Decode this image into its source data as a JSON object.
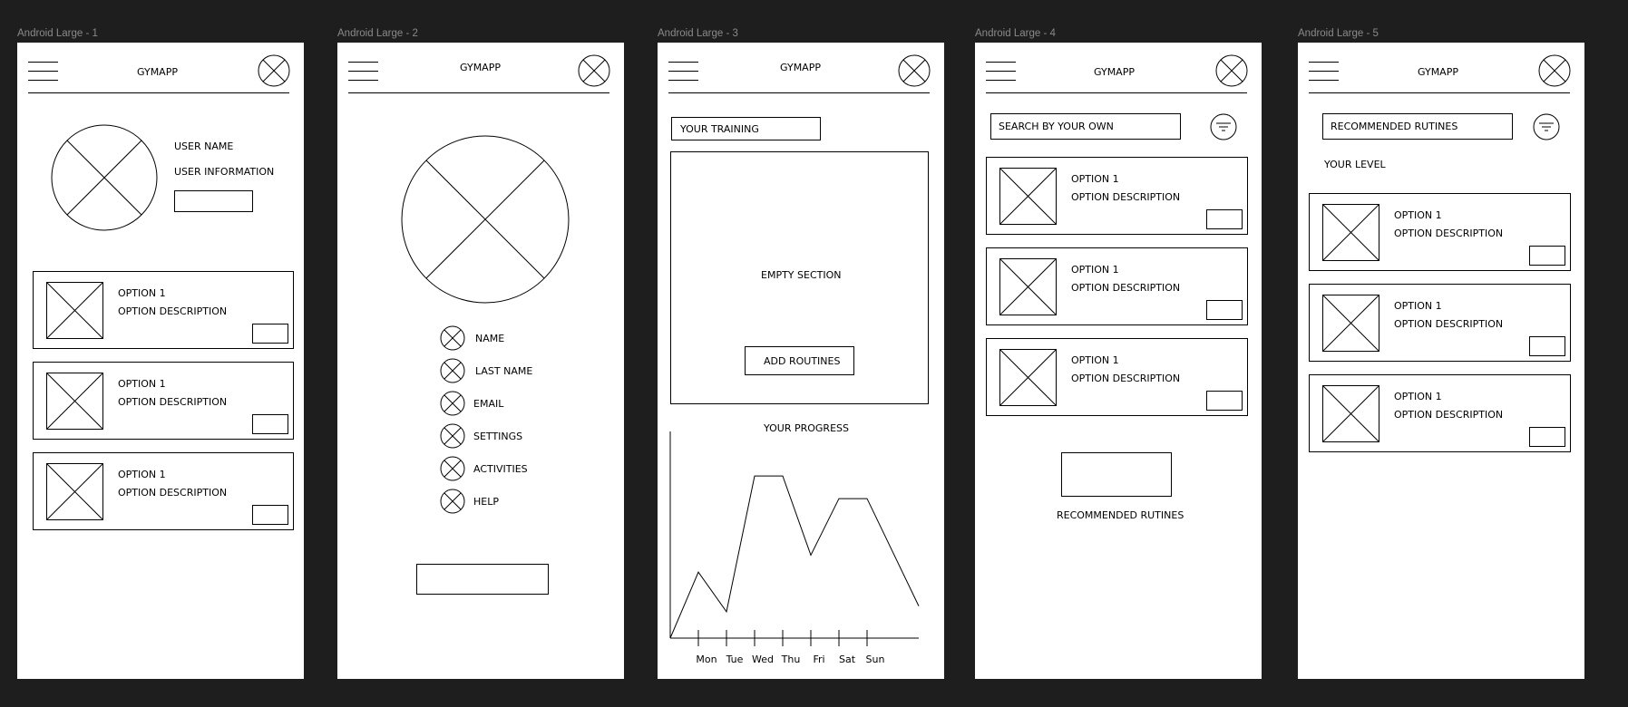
{
  "labels": {
    "f1": "Android Large - 1",
    "f2": "Android Large - 2",
    "f3": "Android Large - 3",
    "f4": "Android Large - 4",
    "f5": "Android Large - 5"
  },
  "app_title": "GYMAPP",
  "profile": {
    "user_name": "USER NAME",
    "user_info": "USER INFORMATION"
  },
  "option": {
    "title": "OPTION 1",
    "description": "OPTION DESCRIPTION"
  },
  "settings_menu": [
    {
      "label": "NAME"
    },
    {
      "label": "LAST NAME"
    },
    {
      "label": "EMAIL"
    },
    {
      "label": "SETTINGS"
    },
    {
      "label": "ACTIVITIES"
    },
    {
      "label": "HELP"
    }
  ],
  "training": {
    "field": "YOUR TRAINING",
    "empty": "EMPTY SECTION",
    "add_button": "ADD ROUTINES",
    "progress_title": "YOUR PROGRESS"
  },
  "search": {
    "placeholder": "SEARCH BY YOUR OWN",
    "recommended_label": "RECOMMENDED RUTINES"
  },
  "recommended": {
    "field": "RECOMMENDED RUTINES",
    "level": "YOUR LEVEL"
  },
  "chart_data": {
    "type": "line",
    "title": "YOUR PROGRESS",
    "categories": [
      "Mon",
      "Tue",
      "Wed",
      "Thu",
      "Fri",
      "Sat",
      "Sun"
    ],
    "series": [
      {
        "values": [
          0,
          35,
          14,
          86,
          86,
          44,
          74,
          74,
          17
        ]
      }
    ],
    "ylim": [
      0,
      100
    ],
    "grid": false,
    "legend": "none"
  }
}
